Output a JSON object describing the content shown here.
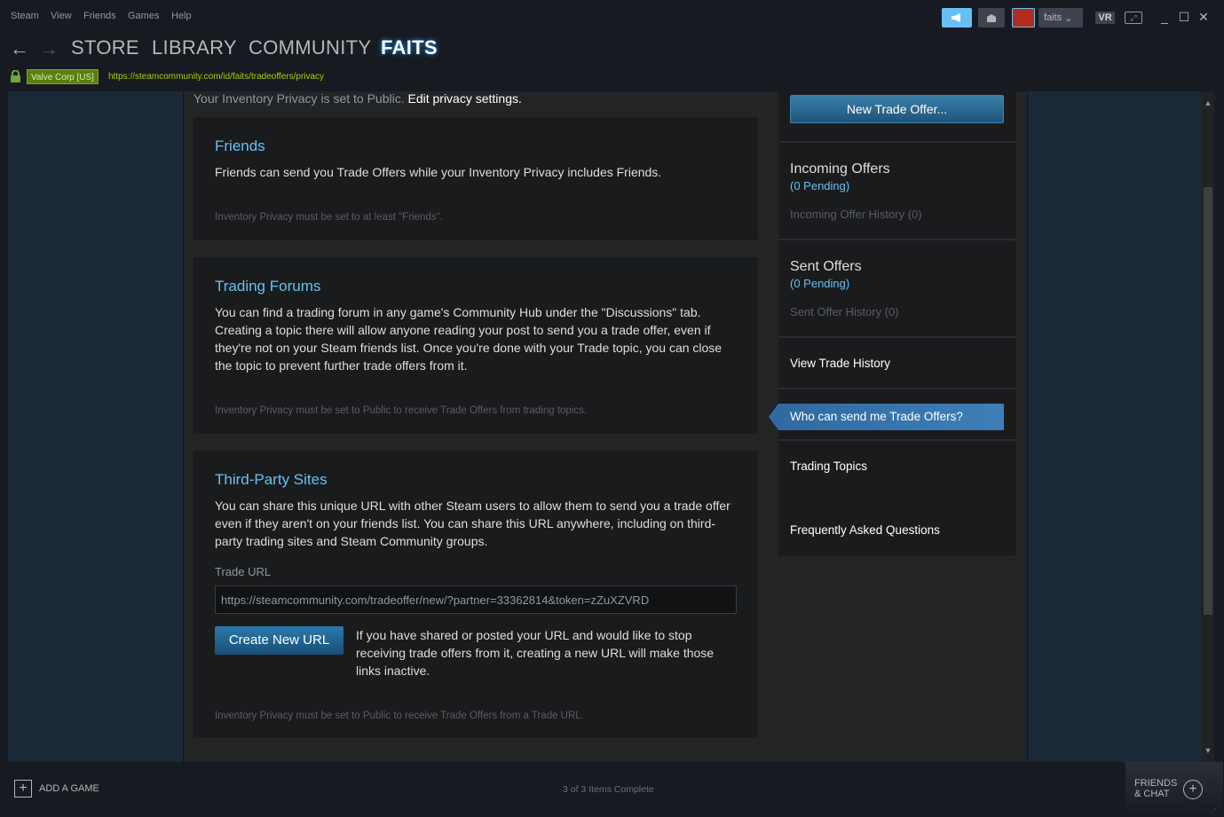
{
  "menu": {
    "items": [
      "Steam",
      "View",
      "Friends",
      "Games",
      "Help"
    ]
  },
  "account": {
    "name": "faits",
    "chevron": "⌄"
  },
  "toolbar": {
    "vr_label": "VR"
  },
  "nav": {
    "back": "←",
    "forward": "→",
    "tabs": [
      "STORE",
      "LIBRARY",
      "COMMUNITY",
      "FAITS"
    ]
  },
  "urlbar": {
    "cert": "Valve Corp [US]",
    "url": "https://steamcommunity.com/id/faits/tradeoffers/privacy"
  },
  "privacy": {
    "text": "Your Inventory Privacy is set to Public.",
    "link": "Edit privacy settings."
  },
  "panels": {
    "friends": {
      "title": "Friends",
      "body": "Friends can send you Trade Offers while your Inventory Privacy includes Friends.",
      "note": "Inventory Privacy must be set to at least \"Friends\"."
    },
    "forums": {
      "title": "Trading Forums",
      "body": "You can find a trading forum in any game's Community Hub under the \"Discussions\" tab. Creating a topic there will allow anyone reading your post to send you a trade offer, even if they're not on your Steam friends list. Once you're done with your Trade topic, you can close the topic to prevent further trade offers from it.",
      "note": "Inventory Privacy must be set to Public to receive Trade Offers from trading topics."
    },
    "third_party": {
      "title": "Third-Party Sites",
      "body": "You can share this unique URL with other Steam users to allow them to send you a trade offer even if they aren't on your friends list. You can share this URL anywhere, including on third-party trading sites and Steam Community groups.",
      "trade_url_label": "Trade URL",
      "trade_url_value": "https://steamcommunity.com/tradeoffer/new/?partner=33362814&token=zZuXZVRD",
      "create_button": "Create New URL",
      "create_desc": "If you have shared or posted your URL and would like to stop receiving trade offers from it, creating a new URL will make those links inactive.",
      "note": "Inventory Privacy must be set to Public to receive Trade Offers from a Trade URL."
    }
  },
  "sidebar": {
    "new_trade": "New Trade Offer...",
    "incoming": {
      "title": "Incoming Offers",
      "pending": "(0 Pending)",
      "history": "Incoming Offer History (0)"
    },
    "sent": {
      "title": "Sent Offers",
      "pending": "(0 Pending)",
      "history": "Sent Offer History (0)"
    },
    "view_history": "View Trade History",
    "who_can_send": "Who can send me Trade Offers?",
    "trading_topics": "Trading Topics",
    "faq": "Frequently Asked Questions"
  },
  "bottom": {
    "add_game": "ADD A GAME",
    "status": "3 of 3 Items Complete",
    "friends_line1": "FRIENDS",
    "friends_line2": "& CHAT"
  },
  "colors": {
    "accent": "#66c0f4",
    "link_blue": "#66c0f4",
    "bg": "#171a21",
    "page": "#222426",
    "panel": "#1a1b1d",
    "secure_green": "#a4d007"
  },
  "icons": [
    "announcement-icon",
    "mail-icon",
    "lock-icon",
    "back-arrow-icon",
    "forward-arrow-icon",
    "add-icon",
    "friends-add-icon"
  ]
}
